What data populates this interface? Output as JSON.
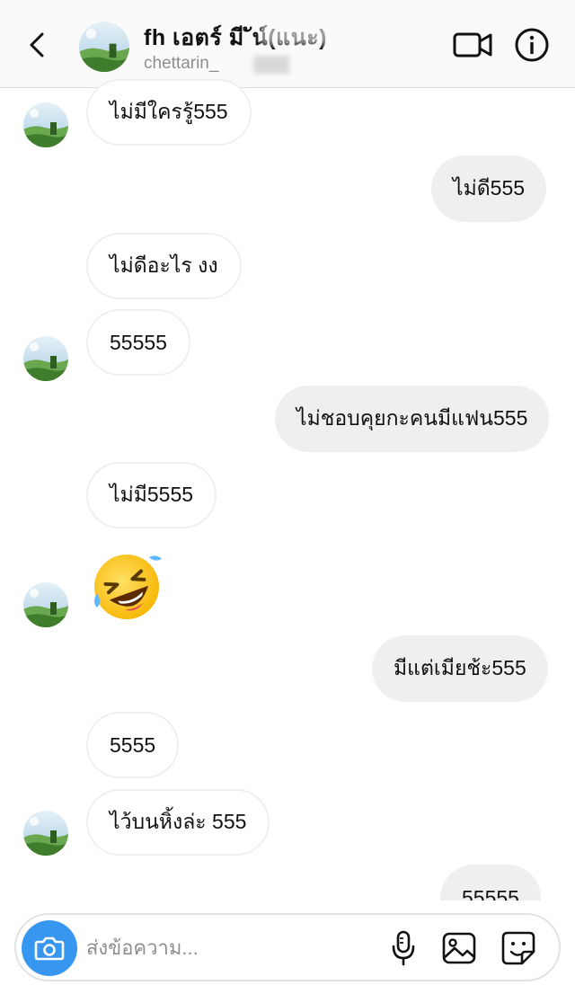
{
  "header": {
    "contact_name": "fh เอตร์ มี ัน์(แนะ)",
    "username": "chettarin_",
    "back_icon": "chevron-left-icon",
    "video_icon": "video-camera-icon",
    "info_icon": "info-icon"
  },
  "messages": [
    {
      "side": "in",
      "text": "ไม่มีใครรู้555"
    },
    {
      "side": "out",
      "text": "ไม่ดี555"
    },
    {
      "side": "in",
      "text": "ไม่ดีอะไร งง"
    },
    {
      "side": "in",
      "text": "55555"
    },
    {
      "side": "out",
      "text": "ไม่ชอบคุยกะคนมีแฟน555"
    },
    {
      "side": "in",
      "text": "ไม่มี5555"
    },
    {
      "side": "in",
      "emoji": "rolling-on-floor-laughing"
    },
    {
      "side": "out",
      "text": "มีแต่เมียช้ะ555"
    },
    {
      "side": "in",
      "text": "5555"
    },
    {
      "side": "in",
      "text": "ไว้บนหิ้งล่ะ 555"
    },
    {
      "side": "out",
      "text": "55555"
    }
  ],
  "composer": {
    "placeholder": "ส่งข้อความ...",
    "camera_icon": "camera-icon",
    "mic_icon": "microphone-icon",
    "gallery_icon": "image-icon",
    "sticker_icon": "sticker-icon"
  },
  "colors": {
    "accent": "#3797f0",
    "bubble_out": "#efefef",
    "bubble_in_border": "#efefef",
    "secondary_text": "#8e8e8e"
  }
}
